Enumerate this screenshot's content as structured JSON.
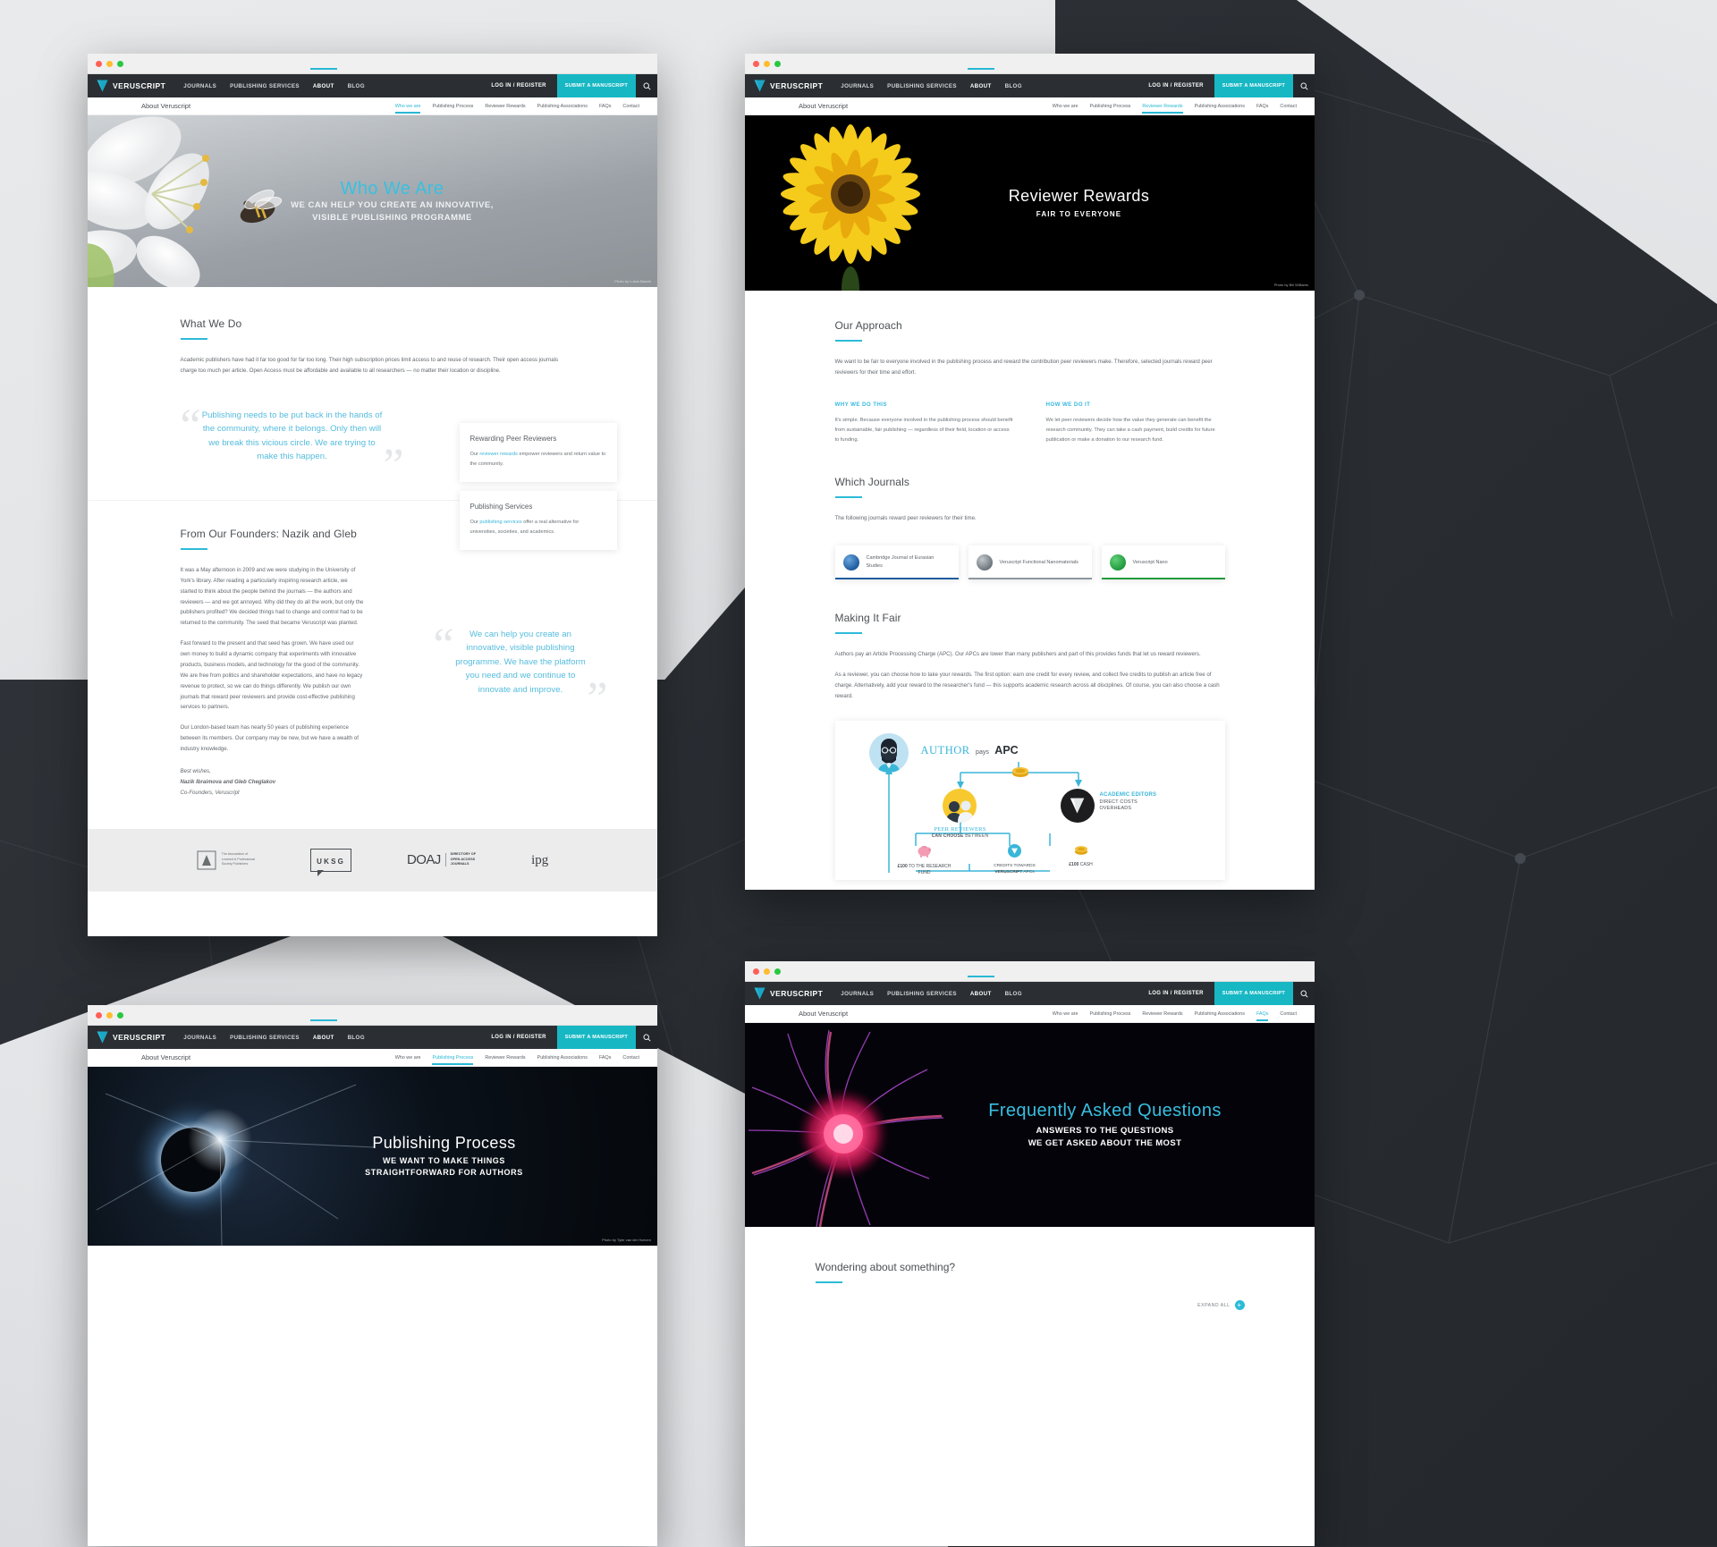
{
  "brand": {
    "name": "VERUSCRIPT",
    "accent": "#29b8d4",
    "teal": "#17b8c4",
    "dark_nav": "#2b2f33"
  },
  "topnav": {
    "links": [
      "JOURNALS",
      "PUBLISHING SERVICES",
      "ABOUT",
      "BLOG"
    ],
    "active": "ABOUT",
    "login_label": "LOG IN / REGISTER",
    "submit_label": "SUBMIT A MANUSCRIPT",
    "search_icon": "search-icon"
  },
  "subnav": {
    "title": "About Veruscript",
    "links": [
      "Who we are",
      "Publishing Process",
      "Reviewer Rewards",
      "Publishing Associations",
      "FAQs",
      "Contact"
    ]
  },
  "panels": [
    {
      "id": "who-we-are",
      "active_subnav": "Who we are",
      "hero": {
        "title": "Who We Are",
        "subtitle_line1": "WE CAN HELP YOU CREATE AN INNOVATIVE,",
        "subtitle_line2": "VISIBLE PUBLISHING PROGRAMME",
        "photo_credit": "Photo by Lukas Blazek"
      },
      "what_we_do": {
        "title": "What We Do",
        "paragraph": "Academic publishers have had it far too good for far too long. Their high subscription prices limit access to and reuse of research. Their open access journals charge too much per article. Open Access must be affordable and available to all researchers — no matter their location or discipline.",
        "quote": "Publishing needs to be put back in the hands of the community, where it belongs. Only then will we break this vicious circle. We are trying to make this happen.",
        "cards": [
          {
            "title": "Rewarding Peer Reviewers",
            "text_before": "Our ",
            "link": "reviewer rewards",
            "text_after": " empower reviewers and return value to the community."
          },
          {
            "title": "Publishing Services",
            "text_before": "Our ",
            "link": "publishing services",
            "text_after": " offer a real alternative for universities, societies, and academics."
          }
        ]
      },
      "founders": {
        "title": "From Our Founders: Nazik and Gleb",
        "paragraphs": [
          "It was a May afternoon in 2009 and we were studying in the University of York's library. After reading a particularly inspiring research article, we started to think about the people behind the journals — the authors and reviewers — and we got annoyed. Why did they do all the work, but only the publishers profited? We decided things had to change and control had to be returned to the community. The seed that became Veruscript was planted.",
          "Fast forward to the present and that seed has grown. We have used our own money to build a dynamic company that experiments with innovative products, business models, and technology for the good of the community. We are free from politics and shareholder expectations, and have no legacy revenue to protect, so we can do things differently. We publish our own journals that reward peer reviewers and provide cost-effective publishing services to partners.",
          "Our London-based team has nearly 50 years of publishing experience between its members. Our company may be new, but we have a wealth of industry knowledge."
        ],
        "signoff": "Best wishes,",
        "signature_names": "Nazik Ibraimova and Gleb Cheglakov",
        "signature_role": "Co-Founders, Veruscript",
        "quote": "We can help you create an innovative, visible publishing programme. We have the platform you need and we continue to innovate and improve."
      },
      "partner_logos": [
        {
          "name": "alpsp-logo",
          "line1": "The Association of",
          "line2": "Learned & Professional",
          "line3": "Society Publishers"
        },
        {
          "name": "uksg-logo",
          "text": "UKSG"
        },
        {
          "name": "doaj-logo",
          "text": "DOAJ",
          "sub1": "DIRECTORY OF",
          "sub2": "OPEN ACCESS",
          "sub3": "JOURNALS"
        },
        {
          "name": "ipg-logo",
          "text": "ipg"
        }
      ]
    },
    {
      "id": "reviewer-rewards",
      "active_subnav": "Reviewer Rewards",
      "hero": {
        "title": "Reviewer Rewards",
        "subtitle_line1": "FAIR TO EVERYONE",
        "photo_credit": "Photo by Bill Williams"
      },
      "our_approach": {
        "title": "Our Approach",
        "paragraph": "We want to be fair to everyone involved in the publishing process and reward the contribution peer reviewers make. Therefore, selected journals reward peer reviewers for their time and effort.",
        "columns": [
          {
            "heading": "WHY WE DO THIS",
            "text": "It's simple. Because everyone involved in the publishing process should benefit from sustainable, fair publishing — regardless of their field, location or access to funding."
          },
          {
            "heading": "HOW WE DO IT",
            "text": "We let peer reviewers decide how the value they generate can benefit the research community. They can take a cash payment, build credits for future publication or make a donation to our research fund."
          }
        ]
      },
      "which_journals": {
        "title": "Which Journals",
        "paragraph": "The following journals reward peer reviewers for their time.",
        "cards": [
          {
            "name": "Cambridge Journal of Eurasian Studies",
            "color": "#1f5c9e"
          },
          {
            "name": "Veruscript Functional Nanomaterials",
            "color": "#8f979e"
          },
          {
            "name": "Veruscript Nano",
            "color": "#1f9a3c"
          }
        ]
      },
      "making_it_fair": {
        "title": "Making It Fair",
        "paragraphs": [
          "Authors pay an Article Processing Charge (APC). Our APCs are lower than many publishers and part of this provides funds that let us reward reviewers.",
          "As a reviewer, you can choose how to take your rewards. The first option: earn one credit for every review, and collect five credits to publish an article free of charge. Alternatively, add your reward to the researcher's fund — this supports academic research across all disciplines. Of course, you can also choose a cash reward."
        ]
      },
      "infographic": {
        "author_label": "AUTHOR",
        "author_pays": "pays",
        "apc_label": "APC",
        "peer_reviewers_label": "PEER REVIEWERS",
        "can_choose": "CAN CHOOSE",
        "between": "BETWEEN",
        "academic_editors": "ACADEMIC EDITORS",
        "direct_costs": "DIRECT COSTS",
        "overheads": "OVERHEADS",
        "option1_amount": "£100",
        "option1_label": "TO THE RESEARCH FUND",
        "option2_label_a": "CREDITS TOWARDS",
        "option2_brand": "VERUSCRIPT",
        "option2_label_b": "APCs",
        "option3_amount": "£100",
        "option3_label": "CASH"
      }
    },
    {
      "id": "publishing-process",
      "active_subnav": "Publishing Process",
      "hero": {
        "title": "Publishing Process",
        "subtitle_line1": "WE WANT TO MAKE THINGS",
        "subtitle_line2": "STRAIGHTFORWARD FOR AUTHORS",
        "photo_credit": "Photo by Tyler van der Hoeven"
      }
    },
    {
      "id": "faqs",
      "active_subnav": "FAQs",
      "hero": {
        "title": "Frequently Asked Questions",
        "subtitle_line1": "ANSWERS TO THE QUESTIONS",
        "subtitle_line2": "WE GET ASKED ABOUT THE MOST"
      },
      "faq": {
        "title": "Wondering about something?",
        "expand_all": "EXPAND ALL",
        "expand_icon": "plus-icon"
      }
    }
  ]
}
